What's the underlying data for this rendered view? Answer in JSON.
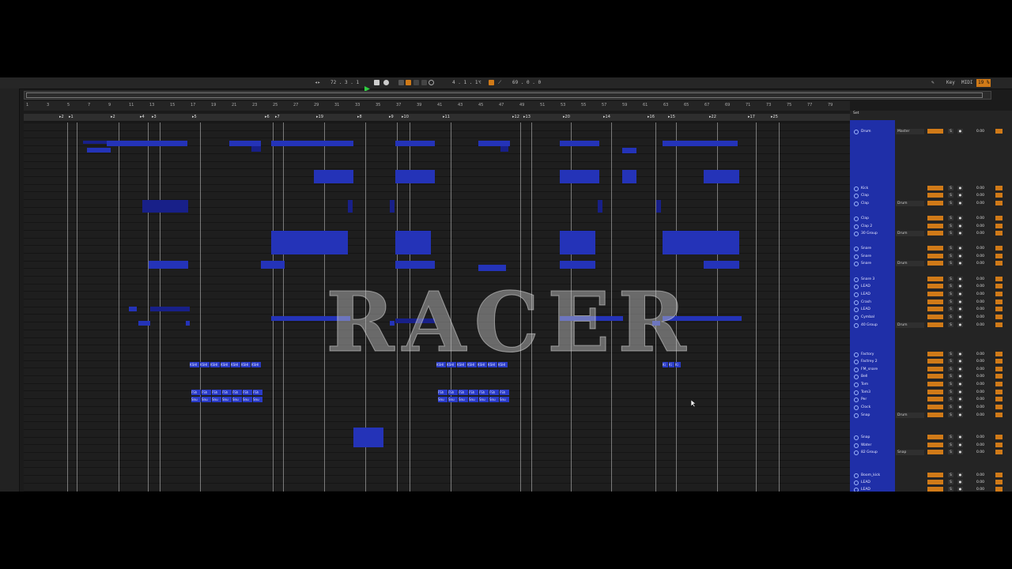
{
  "transport": {
    "tempo": "72 . 3 . 1",
    "position": "4 . 1 . 1",
    "loop_length": "69 . 0 . 0",
    "key_label": "Key",
    "midi_label": "MIDI",
    "cpu": "19 %"
  },
  "ruler": {
    "bars": [
      "1",
      "3",
      "5",
      "7",
      "9",
      "11",
      "13",
      "15",
      "17",
      "19",
      "21",
      "23",
      "25",
      "27",
      "29",
      "31",
      "33",
      "35",
      "37",
      "39",
      "41",
      "43",
      "45",
      "47",
      "49",
      "51",
      "53",
      "55",
      "57",
      "59",
      "61",
      "63",
      "65",
      "67",
      "69",
      "71",
      "73",
      "75",
      "77",
      "79"
    ]
  },
  "locators": [
    "2",
    "1",
    "2",
    "4",
    "3",
    "5",
    "6",
    "7",
    "19",
    "8",
    "9",
    "10",
    "11",
    "12",
    "13",
    "20",
    "14",
    "16",
    "15",
    "22",
    "17",
    "25"
  ],
  "watermark": "RACER",
  "clip_labels": {
    "kshi": "KSHI",
    "fsh": "FSh",
    "snu": "Snu",
    "kick_small": "Ki",
    "set": "Set"
  },
  "tracks": [
    {
      "name": "Drum",
      "route": "Master",
      "db": "0.00"
    },
    {
      "name": "Kick",
      "route": "",
      "db": "0.00"
    },
    {
      "name": "Clap",
      "route": "",
      "db": "0.00"
    },
    {
      "name": "Clap",
      "route": "Drum",
      "db": "0.00"
    },
    {
      "name": "Clap",
      "route": "",
      "db": "0.00"
    },
    {
      "name": "Clap 2",
      "route": "",
      "db": "0.00"
    },
    {
      "name": "30 Group",
      "route": "Drum",
      "db": "0.00"
    },
    {
      "name": "Snare",
      "route": "",
      "db": "0.00"
    },
    {
      "name": "Snare",
      "route": "",
      "db": "0.00"
    },
    {
      "name": "Snare",
      "route": "Drum",
      "db": "0.00"
    },
    {
      "name": "Snare 3",
      "route": "",
      "db": "0.00"
    },
    {
      "name": "LEAD",
      "route": "",
      "db": "0.00"
    },
    {
      "name": "LEAD",
      "route": "",
      "db": "0.00"
    },
    {
      "name": "Crash",
      "route": "",
      "db": "0.00"
    },
    {
      "name": "LEAD",
      "route": "",
      "db": "0.00"
    },
    {
      "name": "Cymbal",
      "route": "",
      "db": "0.00"
    },
    {
      "name": "40 Group",
      "route": "Drum",
      "db": "0.00"
    },
    {
      "name": "Factory",
      "route": "",
      "db": "0.00"
    },
    {
      "name": "Factrey 2",
      "route": "",
      "db": "0.00"
    },
    {
      "name": "FM_snare",
      "route": "",
      "db": "0.00"
    },
    {
      "name": "Bell",
      "route": "",
      "db": "0.00"
    },
    {
      "name": "Tom",
      "route": "",
      "db": "0.00"
    },
    {
      "name": "Tom3",
      "route": "",
      "db": "0.00"
    },
    {
      "name": "Per",
      "route": "",
      "db": "0.00"
    },
    {
      "name": "Clock",
      "route": "",
      "db": "0.00"
    },
    {
      "name": "Snap",
      "route": "Drum",
      "db": "0.00"
    },
    {
      "name": "Snap",
      "route": "",
      "db": "0.00"
    },
    {
      "name": "Water",
      "route": "",
      "db": "0.00"
    },
    {
      "name": "82 Group",
      "route": "Snap",
      "db": "0.00"
    },
    {
      "name": "Boom_kick",
      "route": "",
      "db": "0.00"
    },
    {
      "name": "LEAD",
      "route": "",
      "db": "0.00"
    },
    {
      "name": "LEAD",
      "route": "",
      "db": "0.00"
    }
  ],
  "colors": {
    "clip": "#2433b8",
    "track_bg": "#1f2fa8",
    "orange": "#d07a18",
    "play": "#2ecc40"
  },
  "icons": [
    "play-icon",
    "stop-icon",
    "record-icon",
    "loop-icon",
    "pencil-icon",
    "mouse-cursor-icon"
  ]
}
